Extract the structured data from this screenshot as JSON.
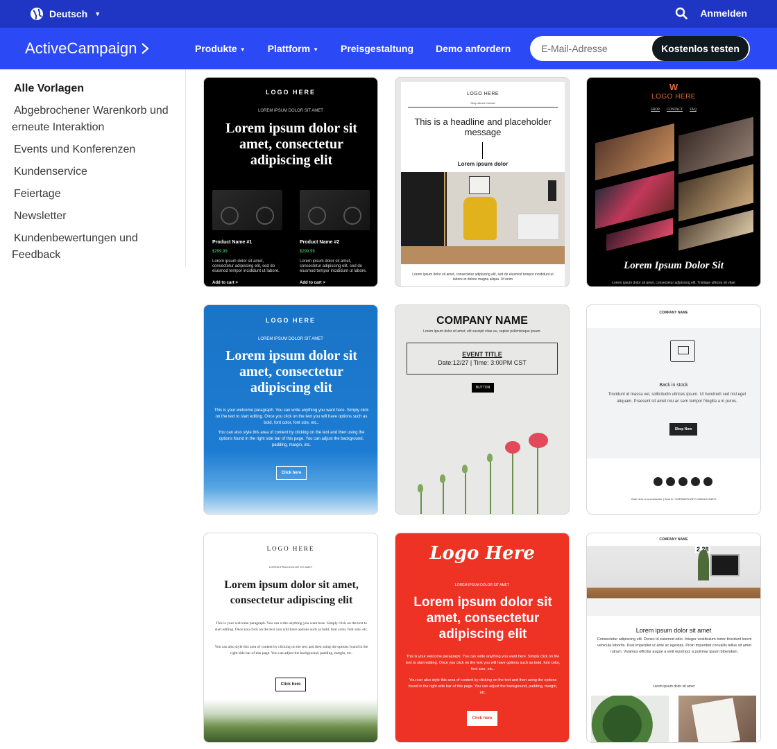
{
  "topbar": {
    "language": "Deutsch",
    "login": "Anmelden"
  },
  "header": {
    "logo": "ActiveCampaign",
    "nav": [
      {
        "label": "Produkte"
      },
      {
        "label": "Plattform"
      },
      {
        "label": "Preisgestaltung"
      },
      {
        "label": "Demo anfordern"
      }
    ],
    "email_placeholder": "E-Mail-Adresse",
    "cta": "Kostenlos testen"
  },
  "sidebar": {
    "items": [
      {
        "label": "Alle Vorlagen"
      },
      {
        "label": "Abgebrochener Warenkorb und erneute Interaktion"
      },
      {
        "label": "Events und Konferenzen"
      },
      {
        "label": "Kundenservice"
      },
      {
        "label": "Feiertage"
      },
      {
        "label": "Newsletter"
      },
      {
        "label": "Kundenbewertungen und Feedback"
      }
    ]
  },
  "templates": {
    "t1": {
      "logo": "LOGO HERE",
      "pretitle": "LOREM IPSUM DOLOR SIT AMET",
      "headline": "Lorem ipsum dolor sit amet, consectetur adipiscing elit",
      "products": [
        {
          "name": "Product Name #1",
          "price": "$299.99",
          "desc": "Lorem ipsum dolor sit amet, consectetur adipiscing elit, sed do eiusmod tempor incididunt ut labore.",
          "cta": "Add to cart >"
        },
        {
          "name": "Product Name #2",
          "price": "$299.99",
          "desc": "Lorem ipsum dolor sit amet, consectetur adipiscing elit, sed do eiusmod tempor incididunt ut labore.",
          "cta": "Add to cart >"
        }
      ]
    },
    "t2": {
      "logo": "LOGO HERE",
      "nav": "Shop      About      Contact",
      "headline": "This is a headline and placeholder message",
      "sub": "Lorem ipsum dolor",
      "footer": "Lorem ipsum dolor sit amet, consectetur adipiscing elit, sed do eiusmod tempor incididunt ut labore et dolore magna aliqua. Ut enim"
    },
    "t3": {
      "monogram": "W",
      "logo": "LOGO HERE",
      "nav": [
        "SHOP",
        "CONTACT",
        "FAQ"
      ],
      "headline": "Lorem Ipsum Dolor Sit",
      "footer": "Lorem ipsum dolor sit amet, consectetur adipiscing elit. Tristique ultrices sit vitae"
    },
    "t4": {
      "logo": "LOGO HERE",
      "pretitle": "LOREM IPSUM DOLOR SIT AMET",
      "headline": "Lorem ipsum dolor sit amet, consectetur adipiscing elit",
      "p1": "This is your welcome paragraph. You can write anything you want here. Simply click on the text to start editing. Once you click on the text you will have options such as bold, font color, font size, etc..",
      "p2": "You can also style this area of content by clicking on the text and then using the options found in the right side bar of this page. You can adjust the background, padding, margin, etc.",
      "button": "Click here"
    },
    "t5": {
      "company": "COMPANY NAME",
      "sub": "Lorem ipsum dolor sit amet, elit suscipit vitae eu, sapien pellentesque ipsum.",
      "event_title": "EVENT TITLE",
      "date": "Date:12/27   |   Time: 3:00PM CST",
      "button": "BUTTON"
    },
    "t6": {
      "company": "COMPANY NAME",
      "title": "Back in stock",
      "text": "Tincidunt id massa vel, sollicitudin ultrices ipsum. Ut hendrerit sed nisl eget aliquam. Praesent sit amet nisi ac sem tempor fringilla a in purus.",
      "button": "Shop Now",
      "unsubscribe": "Click here to unsubscribe  |  Sent to: %SENDER-INFO-SINGLELINE%"
    },
    "t7": {
      "logo": "LOGO HERE",
      "pretitle": "LOREM IPSUM DOLOR SIT AMET",
      "headline": "Lorem ipsum dolor sit amet, consectetur adipiscing elit",
      "p1": "This is your welcome paragraph. You can write anything you want here. Simply click on the text to start editing. Once you click on the text you will have options such as bold, font color, font size, etc.",
      "p2": "You can also style this area of content by clicking on the text and then using the options found in the right side bar of this page. You can adjust the background, padding, margin, etc.",
      "button": "Click here"
    },
    "t8": {
      "logo": "Logo Here",
      "pretitle": "LOREM IPSUM DOLOR SIT AMET",
      "headline": "Lorem ipsum dolor sit amet, consectetur adipiscing elit",
      "p1": "This is your welcome paragraph. You can write anything you want here. Simply click on the text to start editing. Once you click on the text you will have options such as bold, font color, font size, etc..",
      "p2": "You can also style this area of content by clicking on the text and then using the options found in the right side bar of this page. You can adjust the background, padding, margin, etc.",
      "button": "Click here"
    },
    "t9": {
      "company": "COMPANY NAME",
      "clock": "2 28",
      "headline": "Lorem ipsum dolor sit amet",
      "text": "Consectetur adipiscing elit. Donec id euismod odio. Integer vestibulum tortor tincidunt lorem vehicula lobortis. Duis imperdiet ut ante ac egestas. Proin imperdiet convallis tellus sit amet rutrum. Vivamus efficitur augue a velit euismod, a pulvinar ipsum bibendum.",
      "sub2": "Lorem ipsum dolor sit amet"
    }
  },
  "colors": {
    "topbar": "#1f35c4",
    "navbar": "#2b49f4",
    "cta_bg": "#0e1a1f",
    "card_red": "#ee3224",
    "card_blue": "#1a74c6"
  }
}
